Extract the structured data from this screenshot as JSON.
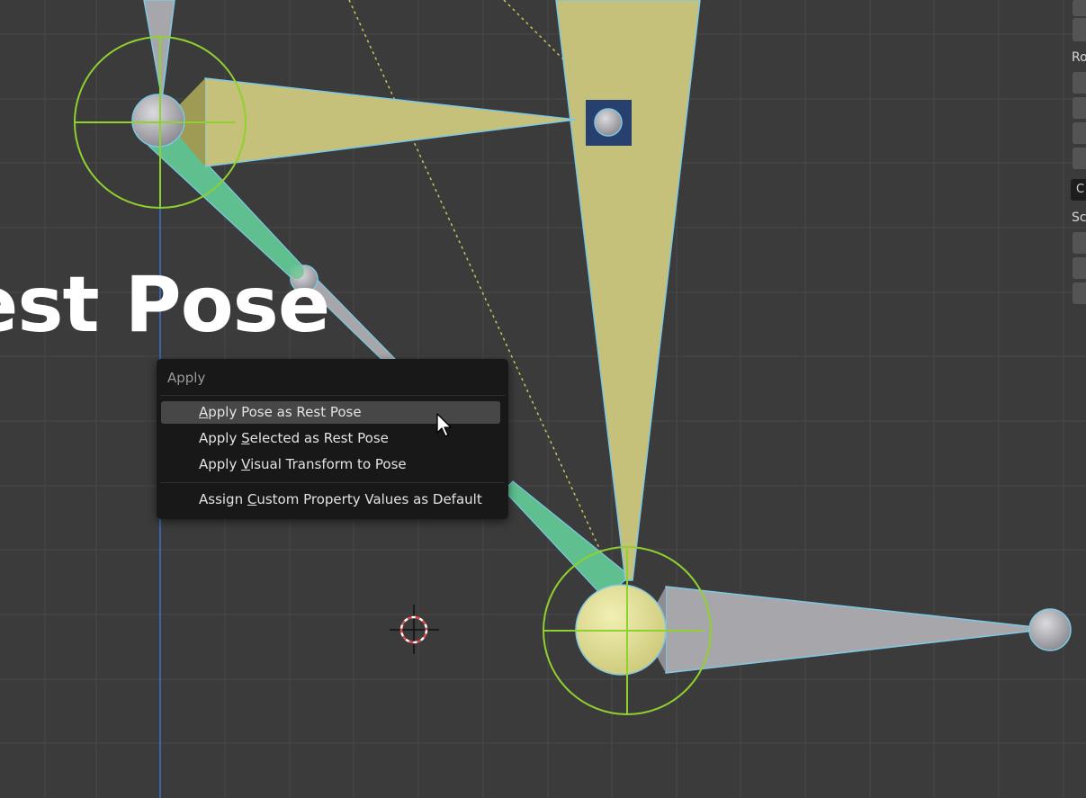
{
  "viewport": {
    "overlay_text": "est Pose"
  },
  "context_menu": {
    "title": "Apply",
    "items": [
      {
        "label": "Apply Pose as Rest Pose",
        "mnemonic": "A",
        "active": true
      },
      {
        "label": "Apply Selected as Rest Pose",
        "mnemonic": "S",
        "active": false
      },
      {
        "label": "Apply Visual Transform to Pose",
        "mnemonic": "V",
        "active": false
      },
      {
        "label": "Assign Custom Property Values as Default",
        "mnemonic": "C",
        "active": false
      }
    ]
  },
  "side_panel": {
    "labels": [
      "Ro",
      "Sc"
    ],
    "dropdown_text": "C"
  },
  "colors": {
    "viewport_bg": "#3b3b3b",
    "grid_line": "#4a4a4a",
    "bone_selected": "#c6c17a",
    "bone_connection": "#5fbf8e",
    "bone_unselected": "#a7a7ab",
    "bone_outline": "#7ec8e3",
    "circle_widget": "#8fd12e",
    "z_axis": "#3a63b0",
    "menu_bg": "#181818",
    "menu_highlight": "#474747"
  },
  "icons": [
    "3d-cursor-icon",
    "mouse-pointer-icon",
    "bone-head-icon"
  ]
}
